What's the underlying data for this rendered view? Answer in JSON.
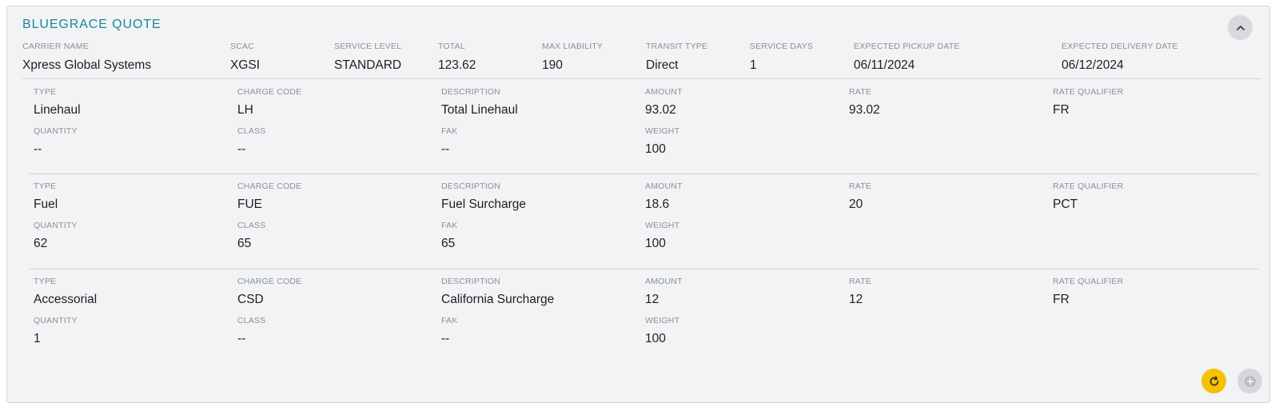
{
  "quote": {
    "title": "BLUEGRACE QUOTE",
    "fields": [
      {
        "label": "CARRIER NAME",
        "value": "Xpress Global Systems"
      },
      {
        "label": "SCAC",
        "value": "XGSI"
      },
      {
        "label": "SERVICE LEVEL",
        "value": "STANDARD"
      },
      {
        "label": "TOTAL",
        "value": "123.62"
      },
      {
        "label": "MAX LIABILITY",
        "value": "190"
      },
      {
        "label": "TRANSIT TYPE",
        "value": "Direct"
      },
      {
        "label": "SERVICE DAYS",
        "value": "1"
      },
      {
        "label": "EXPECTED PICKUP DATE",
        "value": "06/11/2024"
      },
      {
        "label": "EXPECTED DELIVERY DATE",
        "value": "06/12/2024"
      }
    ]
  },
  "charge_labels": {
    "type": "TYPE",
    "charge_code": "CHARGE CODE",
    "description": "DESCRIPTION",
    "amount": "AMOUNT",
    "rate": "RATE",
    "rate_qualifier": "RATE QUALIFIER",
    "quantity": "QUANTITY",
    "class": "CLASS",
    "fak": "FAK",
    "weight": "WEIGHT"
  },
  "charges": [
    {
      "type": "Linehaul",
      "charge_code": "LH",
      "description": "Total Linehaul",
      "amount": "93.02",
      "rate": "93.02",
      "rate_qualifier": "FR",
      "quantity": "--",
      "class": "--",
      "fak": "--",
      "weight": "100"
    },
    {
      "type": "Fuel",
      "charge_code": "FUE",
      "description": "Fuel Surcharge",
      "amount": "18.6",
      "rate": "20",
      "rate_qualifier": "PCT",
      "quantity": "62",
      "class": "65",
      "fak": "65",
      "weight": "100"
    },
    {
      "type": "Accessorial",
      "charge_code": "CSD",
      "description": "California Surcharge",
      "amount": "12",
      "rate": "12",
      "rate_qualifier": "FR",
      "quantity": "1",
      "class": "--",
      "fak": "--",
      "weight": "100"
    }
  ],
  "icons": {
    "collapse": "chevron-up-icon",
    "refresh": "refresh-icon",
    "add": "plus-circle-icon"
  },
  "colors": {
    "title": "#1b8795",
    "refresh_button": "#f6c100",
    "disabled_button": "#d5d7da"
  }
}
